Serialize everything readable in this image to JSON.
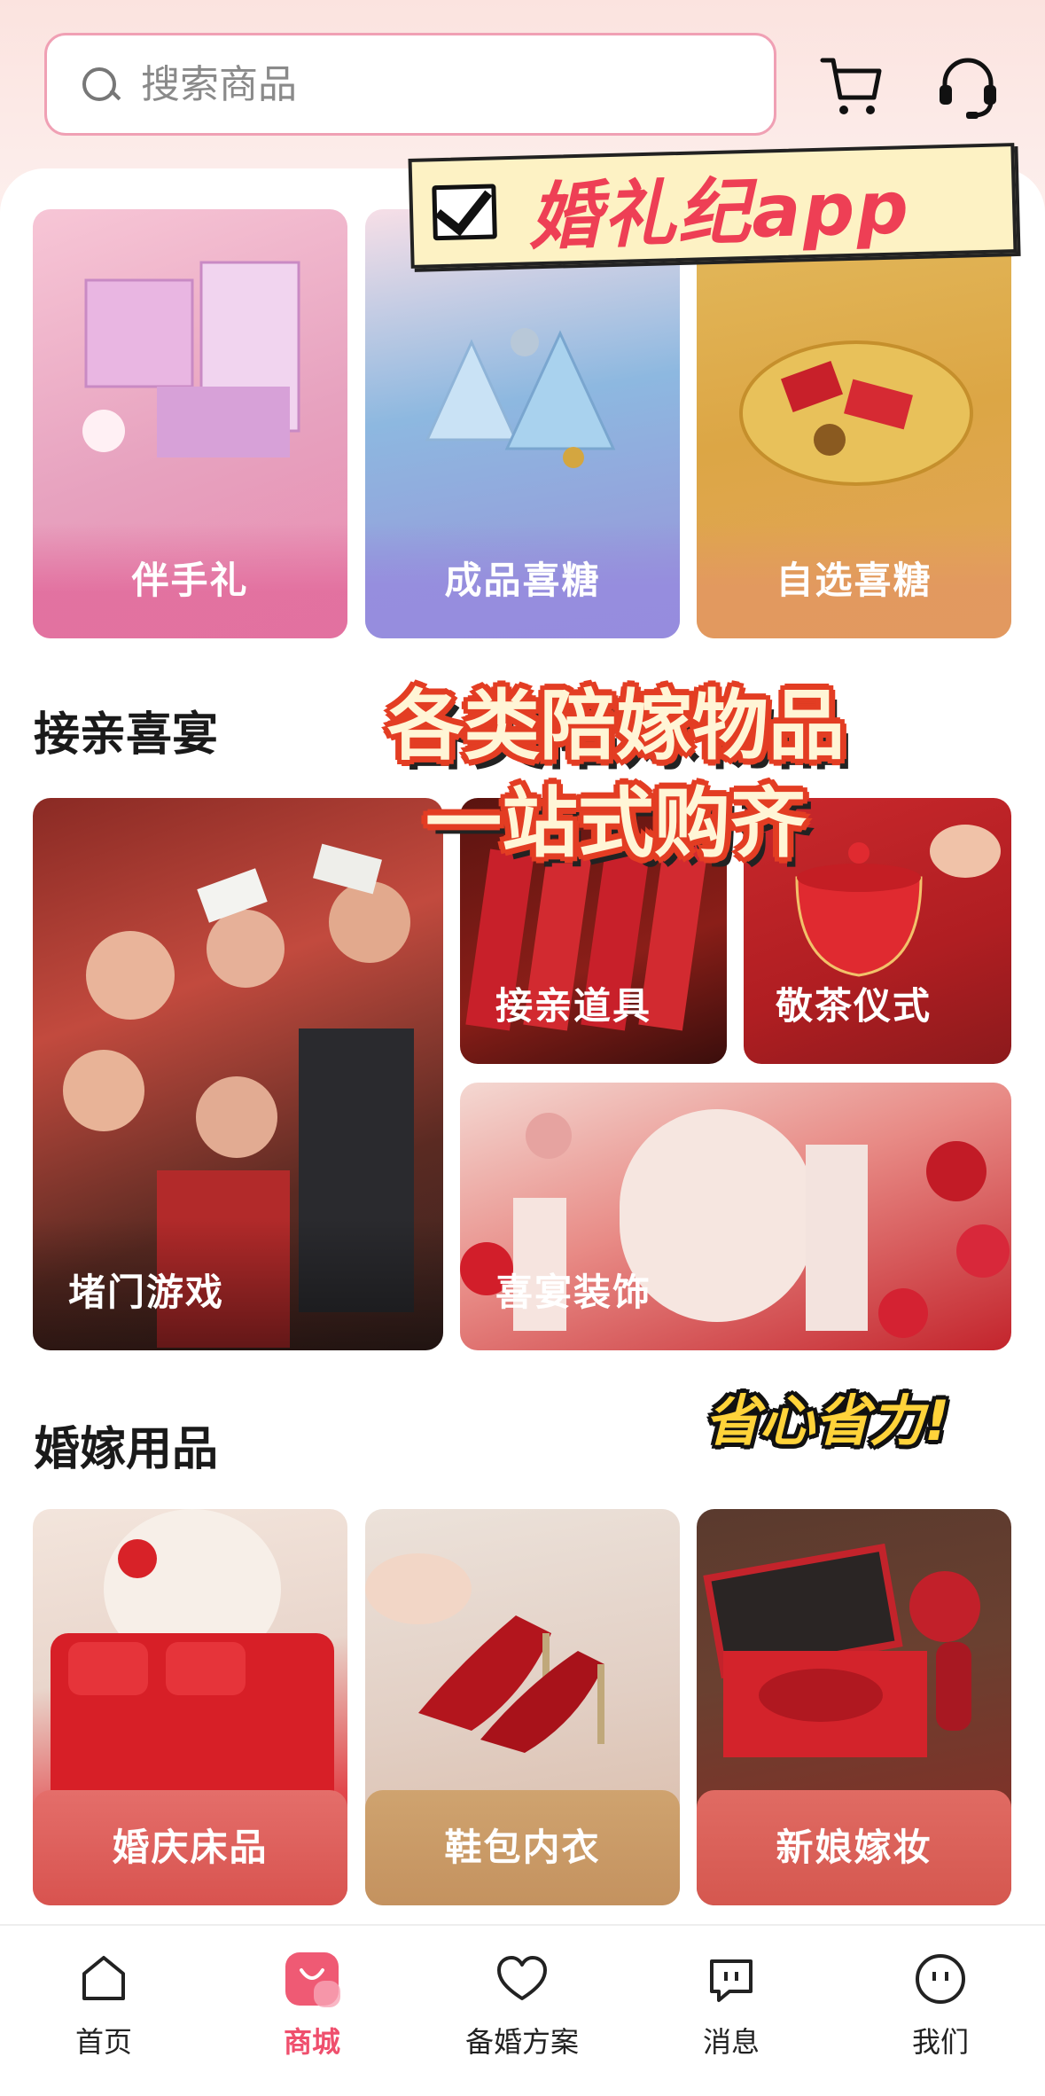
{
  "search": {
    "placeholder": "搜索商品"
  },
  "header_icons": [
    "cart-icon",
    "customer-service-icon"
  ],
  "overlays": {
    "sticker_text": "婚礼纪app",
    "banner_line1": "各类陪嫁物品",
    "banner_line2": "一站式购齐",
    "slogan": "省心省力!"
  },
  "top_categories": [
    {
      "label": "伴手礼"
    },
    {
      "label": "成品喜糖"
    },
    {
      "label": "自选喜糖"
    }
  ],
  "section_pickup": {
    "title": "接亲喜宴",
    "items": [
      {
        "label": "堵门游戏"
      },
      {
        "label": "接亲道具"
      },
      {
        "label": "敬茶仪式"
      },
      {
        "label": "喜宴装饰"
      }
    ]
  },
  "section_wedding_goods": {
    "title": "婚嫁用品",
    "items": [
      {
        "label": "婚庆床品"
      },
      {
        "label": "鞋包内衣"
      },
      {
        "label": "新娘嫁妆"
      }
    ]
  },
  "tabbar": {
    "items": [
      {
        "label": "首页",
        "icon": "home-icon",
        "active": false
      },
      {
        "label": "商城",
        "icon": "shopping-bag-icon",
        "active": true
      },
      {
        "label": "备婚方案",
        "icon": "heart-icon",
        "active": false
      },
      {
        "label": "消息",
        "icon": "message-icon",
        "active": false
      },
      {
        "label": "我们",
        "icon": "face-icon",
        "active": false
      }
    ]
  },
  "colors": {
    "accent": "#ef4f6d",
    "search_border": "#f0a0b4"
  }
}
